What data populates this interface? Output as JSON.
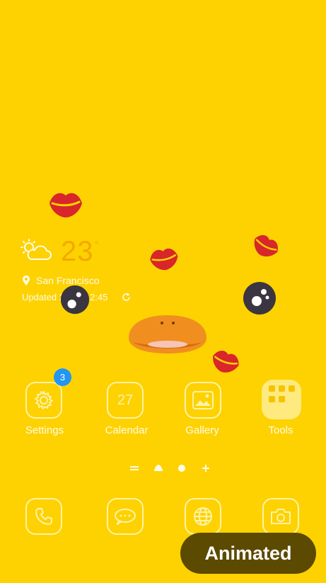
{
  "weather": {
    "temperature": "23",
    "unit": "°",
    "location": "San Francisco",
    "updated": "Updated 24/09 12:45",
    "icon": "cloud-sun-icon"
  },
  "apps": [
    {
      "label": "Settings",
      "icon": "settings-icon",
      "badge": "3"
    },
    {
      "label": "Calendar",
      "icon": "calendar-icon",
      "date": "27"
    },
    {
      "label": "Gallery",
      "icon": "gallery-icon"
    },
    {
      "label": "Tools",
      "icon": "folder-icon"
    }
  ],
  "dock": [
    {
      "icon": "phone-icon"
    },
    {
      "icon": "messages-icon"
    },
    {
      "icon": "internet-icon"
    },
    {
      "icon": "camera-icon"
    }
  ],
  "animated_label": "Animated",
  "colors": {
    "background": "#FDD200",
    "accent": "#F5A800",
    "lips": "#D8262A",
    "badge": "#2196F3"
  }
}
